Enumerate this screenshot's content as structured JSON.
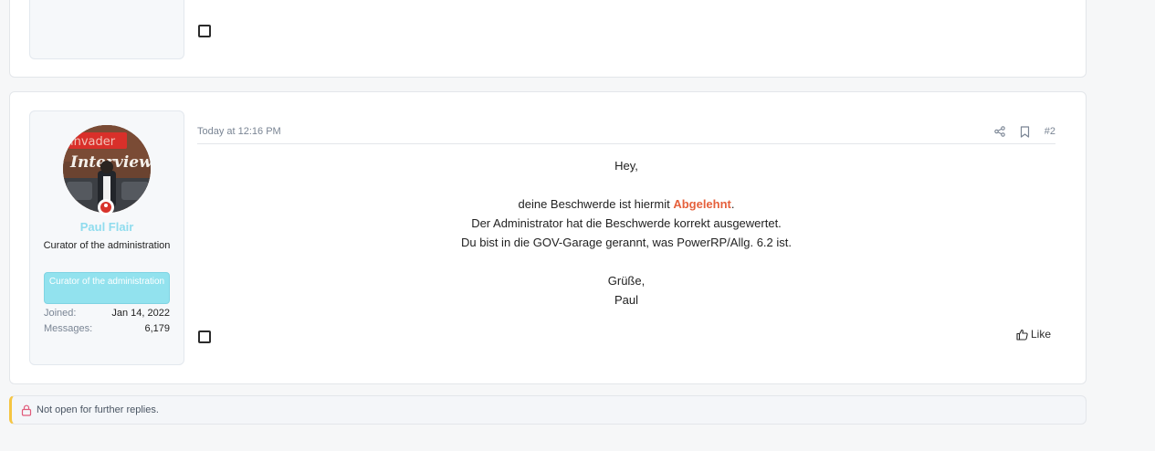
{
  "post": {
    "date": "Today at 12:16 PM",
    "number": "#2",
    "user": {
      "name": "Paul Flair",
      "title": "Curator of the administration",
      "banner": "Curator of the administration",
      "avatar_text_top": "invader",
      "avatar_text_main": "Interview!",
      "joined_label": "Joined:",
      "joined_value": "Jan 14, 2022",
      "messages_label": "Messages:",
      "messages_value": "6,179",
      "name_color": "#8fdcee",
      "status_color": "#d8342c"
    },
    "body": {
      "greeting": "Hey,",
      "line1_prefix": "deine Beschwerde ist hiermit ",
      "line1_highlight": "Abgelehnt",
      "line1_suffix": ".",
      "line2": "Der Administrator hat die Beschwerde korrekt ausgewertet.",
      "line3": "Du bist in die GOV-Garage gerannt, was PowerRP/Allg. 6.2 ist.",
      "closing": "Grüße,",
      "signature": "Paul",
      "highlight_color": "#e5603c"
    },
    "actions": {
      "share_icon": "share-icon",
      "bookmark_icon": "bookmark-icon",
      "like_label": "Like"
    }
  },
  "notice": {
    "text": "Not open for further replies.",
    "icon": "lock-icon",
    "accent": "#f5c542"
  }
}
